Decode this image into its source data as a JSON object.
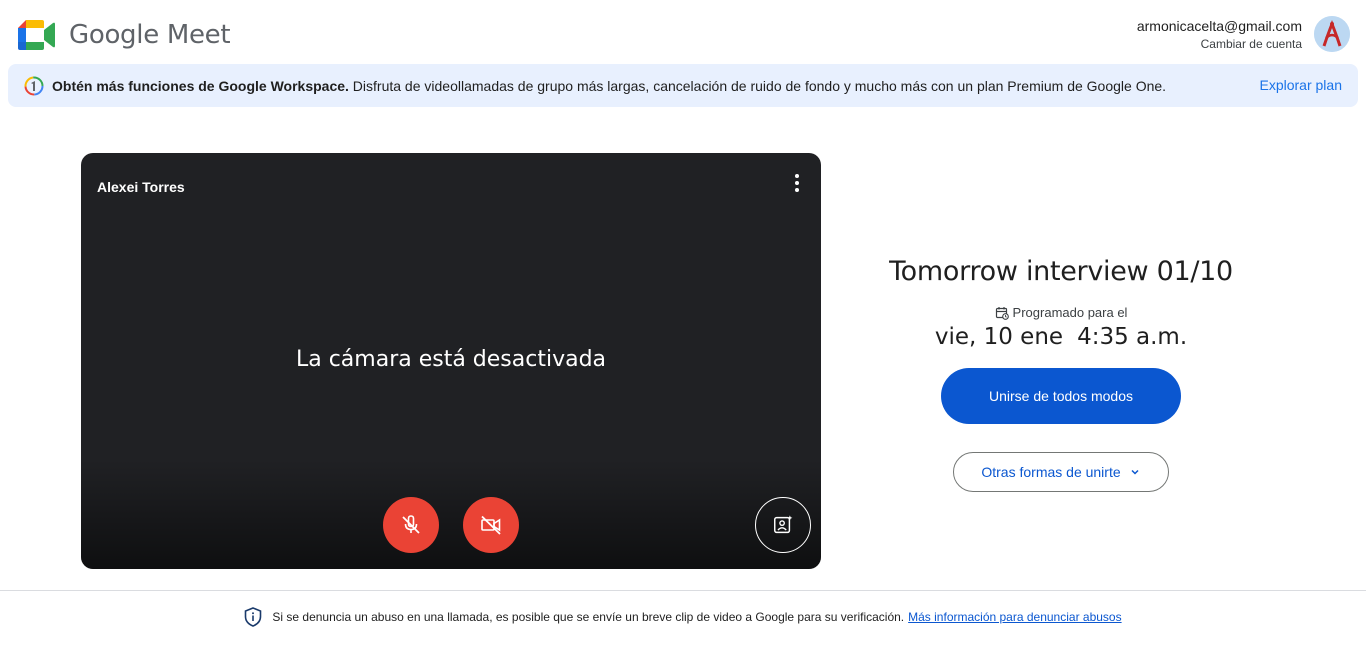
{
  "app": {
    "name": "Google Meet",
    "colors": {
      "primary": "#0b57d0",
      "danger": "#ea4335",
      "banner_bg": "#e8f0fe",
      "preview_bg": "#202124"
    }
  },
  "account": {
    "email": "armonicacelta@gmail.com",
    "switch_label": "Cambiar de cuenta",
    "avatar_icon": "avatar"
  },
  "banner": {
    "icon": "google-one-icon",
    "bold_text": "Obtén más funciones de Google Workspace.",
    "text": " Disfruta de videollamadas de grupo más largas, cancelación de ruido de fondo y mucho más con un plan Premium de Google One.",
    "link": "Explorar plan"
  },
  "preview": {
    "participant_name": "Alexei Torres",
    "camera_off_text": "La cámara está desactivada",
    "controls": {
      "mic": {
        "icon": "mic-off-icon",
        "state": "off"
      },
      "camera": {
        "icon": "videocam-off-icon",
        "state": "off"
      },
      "effects": {
        "icon": "visual-effects-icon"
      },
      "more": {
        "icon": "more-vert-icon"
      }
    }
  },
  "meeting": {
    "title": "Tomorrow interview 01/10",
    "scheduled_label": "Programado para el",
    "date": "vie, 10 ene",
    "time": "4:35 a.m.",
    "join_button": "Unirse de todos modos",
    "other_ways_button": "Otras formas de unirte"
  },
  "footer": {
    "text": "Si se denuncia un abuso en una llamada, es posible que se envíe un breve clip de video a Google para su verificación.",
    "link": "Más información para denunciar abusos"
  }
}
